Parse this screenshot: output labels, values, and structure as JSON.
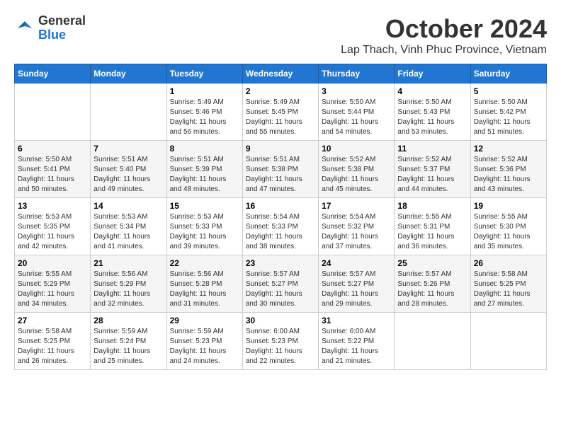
{
  "logo": {
    "general": "General",
    "blue": "Blue"
  },
  "header": {
    "month": "October 2024",
    "location": "Lap Thach, Vinh Phuc Province, Vietnam"
  },
  "weekdays": [
    "Sunday",
    "Monday",
    "Tuesday",
    "Wednesday",
    "Thursday",
    "Friday",
    "Saturday"
  ],
  "weeks": [
    [
      {
        "day": "",
        "info": ""
      },
      {
        "day": "",
        "info": ""
      },
      {
        "day": "1",
        "info": "Sunrise: 5:49 AM\nSunset: 5:46 PM\nDaylight: 11 hours and 56 minutes."
      },
      {
        "day": "2",
        "info": "Sunrise: 5:49 AM\nSunset: 5:45 PM\nDaylight: 11 hours and 55 minutes."
      },
      {
        "day": "3",
        "info": "Sunrise: 5:50 AM\nSunset: 5:44 PM\nDaylight: 11 hours and 54 minutes."
      },
      {
        "day": "4",
        "info": "Sunrise: 5:50 AM\nSunset: 5:43 PM\nDaylight: 11 hours and 53 minutes."
      },
      {
        "day": "5",
        "info": "Sunrise: 5:50 AM\nSunset: 5:42 PM\nDaylight: 11 hours and 51 minutes."
      }
    ],
    [
      {
        "day": "6",
        "info": "Sunrise: 5:50 AM\nSunset: 5:41 PM\nDaylight: 11 hours and 50 minutes."
      },
      {
        "day": "7",
        "info": "Sunrise: 5:51 AM\nSunset: 5:40 PM\nDaylight: 11 hours and 49 minutes."
      },
      {
        "day": "8",
        "info": "Sunrise: 5:51 AM\nSunset: 5:39 PM\nDaylight: 11 hours and 48 minutes."
      },
      {
        "day": "9",
        "info": "Sunrise: 5:51 AM\nSunset: 5:38 PM\nDaylight: 11 hours and 47 minutes."
      },
      {
        "day": "10",
        "info": "Sunrise: 5:52 AM\nSunset: 5:38 PM\nDaylight: 11 hours and 45 minutes."
      },
      {
        "day": "11",
        "info": "Sunrise: 5:52 AM\nSunset: 5:37 PM\nDaylight: 11 hours and 44 minutes."
      },
      {
        "day": "12",
        "info": "Sunrise: 5:52 AM\nSunset: 5:36 PM\nDaylight: 11 hours and 43 minutes."
      }
    ],
    [
      {
        "day": "13",
        "info": "Sunrise: 5:53 AM\nSunset: 5:35 PM\nDaylight: 11 hours and 42 minutes."
      },
      {
        "day": "14",
        "info": "Sunrise: 5:53 AM\nSunset: 5:34 PM\nDaylight: 11 hours and 41 minutes."
      },
      {
        "day": "15",
        "info": "Sunrise: 5:53 AM\nSunset: 5:33 PM\nDaylight: 11 hours and 39 minutes."
      },
      {
        "day": "16",
        "info": "Sunrise: 5:54 AM\nSunset: 5:33 PM\nDaylight: 11 hours and 38 minutes."
      },
      {
        "day": "17",
        "info": "Sunrise: 5:54 AM\nSunset: 5:32 PM\nDaylight: 11 hours and 37 minutes."
      },
      {
        "day": "18",
        "info": "Sunrise: 5:55 AM\nSunset: 5:31 PM\nDaylight: 11 hours and 36 minutes."
      },
      {
        "day": "19",
        "info": "Sunrise: 5:55 AM\nSunset: 5:30 PM\nDaylight: 11 hours and 35 minutes."
      }
    ],
    [
      {
        "day": "20",
        "info": "Sunrise: 5:55 AM\nSunset: 5:29 PM\nDaylight: 11 hours and 34 minutes."
      },
      {
        "day": "21",
        "info": "Sunrise: 5:56 AM\nSunset: 5:29 PM\nDaylight: 11 hours and 32 minutes."
      },
      {
        "day": "22",
        "info": "Sunrise: 5:56 AM\nSunset: 5:28 PM\nDaylight: 11 hours and 31 minutes."
      },
      {
        "day": "23",
        "info": "Sunrise: 5:57 AM\nSunset: 5:27 PM\nDaylight: 11 hours and 30 minutes."
      },
      {
        "day": "24",
        "info": "Sunrise: 5:57 AM\nSunset: 5:27 PM\nDaylight: 11 hours and 29 minutes."
      },
      {
        "day": "25",
        "info": "Sunrise: 5:57 AM\nSunset: 5:26 PM\nDaylight: 11 hours and 28 minutes."
      },
      {
        "day": "26",
        "info": "Sunrise: 5:58 AM\nSunset: 5:25 PM\nDaylight: 11 hours and 27 minutes."
      }
    ],
    [
      {
        "day": "27",
        "info": "Sunrise: 5:58 AM\nSunset: 5:25 PM\nDaylight: 11 hours and 26 minutes."
      },
      {
        "day": "28",
        "info": "Sunrise: 5:59 AM\nSunset: 5:24 PM\nDaylight: 11 hours and 25 minutes."
      },
      {
        "day": "29",
        "info": "Sunrise: 5:59 AM\nSunset: 5:23 PM\nDaylight: 11 hours and 24 minutes."
      },
      {
        "day": "30",
        "info": "Sunrise: 6:00 AM\nSunset: 5:23 PM\nDaylight: 11 hours and 22 minutes."
      },
      {
        "day": "31",
        "info": "Sunrise: 6:00 AM\nSunset: 5:22 PM\nDaylight: 11 hours and 21 minutes."
      },
      {
        "day": "",
        "info": ""
      },
      {
        "day": "",
        "info": ""
      }
    ]
  ]
}
